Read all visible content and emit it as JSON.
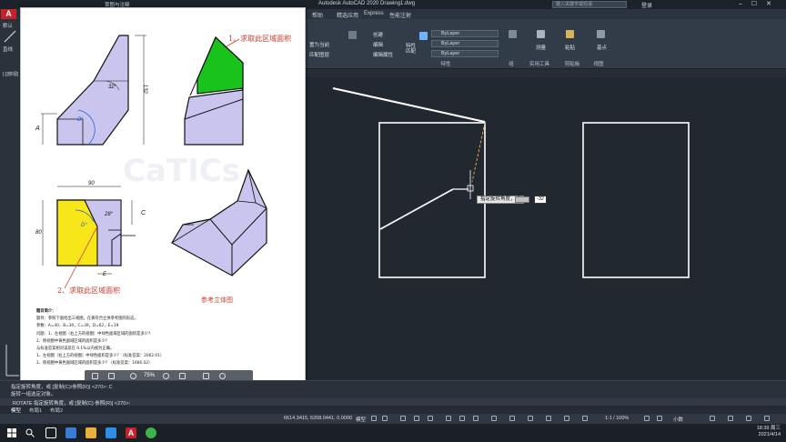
{
  "window": {
    "title": "Autodesk AutoCAD 2020   Drawing1.dwg",
    "search_placeholder": "键入关键字或短语",
    "login": "登录",
    "quick_access_workspace": "草图与注释"
  },
  "menu": {
    "items": [
      "帮助",
      "精选应用",
      "Express",
      "性能注射"
    ]
  },
  "ribbon": {
    "labels": {
      "array_to_front": "置为当前",
      "match_layer": "匹配图层",
      "create": "创建",
      "edit": "编辑",
      "edit_attr": "编辑属性",
      "match_props": "特性匹配",
      "group": "组",
      "measure": "测量",
      "paste": "粘贴",
      "base": "基点"
    },
    "layer_combos": [
      "ByLayer",
      "ByLayer",
      "ByLayer"
    ],
    "groups": [
      "特性",
      "组",
      "实用工具",
      "剪贴板",
      "视图"
    ]
  },
  "left_panel": {
    "default_label": "默认",
    "line_label": "直线",
    "viewport_label": "[-][俯视]"
  },
  "pdf": {
    "annotation_top": "1、求取此区域面积",
    "annotation_bottom": "2、求取此区域面积",
    "reference_label": "参考立体图",
    "dim_labels": {
      "angle32": "32°",
      "dim132": "132",
      "dimA": "A",
      "angleB": "B°",
      "dim90": "90",
      "angle28": "28°",
      "dimC": "C",
      "dim80": "80",
      "angleD": "D°",
      "dimE": "E"
    },
    "problem_lines": [
      "题目简介：",
      "题目：参照下面给出三视图，在黄符合立体参考图的形态。",
      "参数：A=40，B=30，C=39，D=62，E=19",
      "问题：1、左视图（右上方的视图）中绿色面域区域的面积是多少?",
      "2、俯视图中黄色面域区域的面积是多少?",
      "与标准答案相对误差在 0.1%以内视为正确。",
      "1、左视图（右上方的视图）中绿色面积是多少? （标准答案：2062.01）",
      "2、俯视图中黄色面域区域的面积是多少? （标准答案：1666.02）"
    ],
    "zoom": "75%",
    "watermark": "CaTICs"
  },
  "drawing": {
    "tooltip_text": "指定旋转角度，或",
    "angle_input": "-32"
  },
  "command": {
    "line1": "指定旋转角度，或 [复制(C)/参照(R)] <270>:  C",
    "line2": "旋转一组选定对象。",
    "line3": "ROTATE 指定旋转角度，或 [复制(C) 参照(R)] <270>:"
  },
  "tabs": {
    "model": "模型",
    "layout1": "布局1",
    "layout2": "布局2"
  },
  "status": {
    "coords": "6614.3415, 6208.0441, 0.0000",
    "model": "模型",
    "scale": "1:1 / 100%",
    "units": "小数"
  },
  "taskbar": {
    "time": "18:39 周三",
    "date": "2021/4/14"
  },
  "colors": {
    "canvas_bg": "#212830",
    "green_fill": "#19c31c",
    "yellow_fill": "#f6e61a",
    "lavender_fill": "#c9c5ef",
    "annotation_red": "#d23a2d"
  }
}
